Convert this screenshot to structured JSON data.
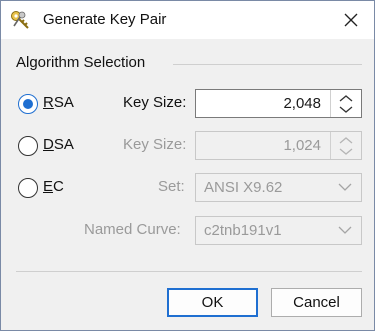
{
  "window": {
    "title": "Generate Key Pair",
    "icons": {
      "app": "key-pair-icon",
      "close": "close-icon"
    }
  },
  "algorithm_section": {
    "title": "Algorithm Selection",
    "options": [
      {
        "mnemonic": "R",
        "rest": "SA",
        "selected": true
      },
      {
        "mnemonic": "D",
        "rest": "SA",
        "selected": false
      },
      {
        "mnemonic": "E",
        "rest": "C",
        "selected": false
      }
    ],
    "rsa": {
      "key_size_label": "Key Size:",
      "key_size_value": "2,048",
      "enabled": true
    },
    "dsa": {
      "key_size_label": "Key Size:",
      "key_size_value": "1,024",
      "enabled": false
    },
    "ec": {
      "set_label": "Set:",
      "set_value": "ANSI X9.62",
      "curve_label": "Named Curve:",
      "curve_value": "c2tnb191v1",
      "enabled": false
    }
  },
  "buttons": {
    "ok_label": "OK",
    "cancel_label": "Cancel"
  },
  "colors": {
    "accent": "#1f6fd1",
    "disabled_text": "#9a9a9a"
  }
}
